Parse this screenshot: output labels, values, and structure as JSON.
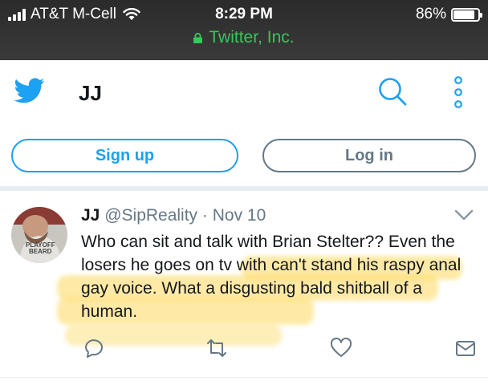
{
  "status_bar": {
    "carrier": "AT&T M-Cell",
    "time": "8:29 PM",
    "battery": "86%",
    "battery_level": 0.86,
    "site": "Twitter, Inc."
  },
  "header": {
    "title": "JJ"
  },
  "buttons": {
    "signup": "Sign up",
    "login": "Log in"
  },
  "tweet": {
    "name": "JJ",
    "handle": "@SipReality",
    "separator": "·",
    "date": "Nov 10",
    "text": "Who can sit and talk with Brian Stelter?? Even the losers he goes on tv with can't stand his raspy anal gay voice. What a disgusting bald shitball of a human.",
    "avatar_text": "PLAYOFF BEARD"
  },
  "colors": {
    "twitter_blue": "#1da1f2",
    "secure_green": "#35c759",
    "highlight": "#fdd85c",
    "gray": "#657786"
  },
  "icons": [
    "twitter-bird-icon",
    "search-icon",
    "more-vertical-icon",
    "chevron-down-icon",
    "reply-icon",
    "retweet-icon",
    "like-icon",
    "message-icon",
    "lock-icon",
    "wifi-icon",
    "signal-icon",
    "battery-icon"
  ]
}
